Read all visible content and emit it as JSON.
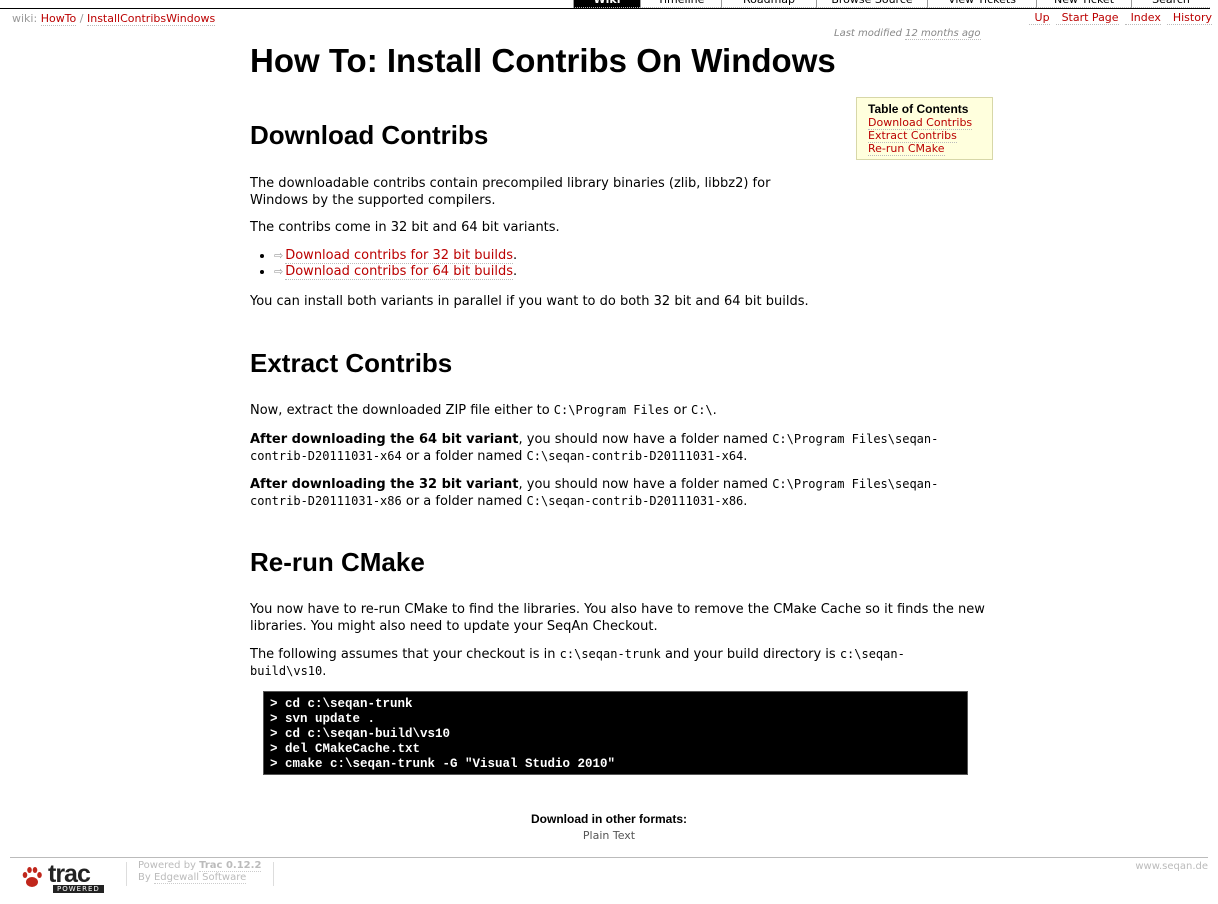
{
  "mainnav": {
    "items": [
      {
        "label": "Wiki",
        "active": true
      },
      {
        "label": "Timeline"
      },
      {
        "label": "Roadmap"
      },
      {
        "label": "Browse Source"
      },
      {
        "label": "View Tickets"
      },
      {
        "label": "New Ticket"
      },
      {
        "label": "Search"
      }
    ]
  },
  "pagepath": {
    "prefix": "wiki:",
    "parent": "HowTo",
    "separator": "/",
    "current": "InstallContribsWindows"
  },
  "ctxnav": {
    "up": "Up",
    "start_page": "Start Page",
    "index": "Index",
    "history": "History"
  },
  "lastmod": {
    "prefix": "Last modified",
    "ago": "12 months ago"
  },
  "page": {
    "title": "How To: Install Contribs On Windows"
  },
  "toc": {
    "title": "Table of Contents",
    "items": [
      "Download Contribs",
      "Extract Contribs",
      "Re-run CMake"
    ]
  },
  "download": {
    "heading": "Download Contribs",
    "p1": "The downloadable contribs contain precompiled library binaries (zlib, libbz2) for Windows by the supported compilers.",
    "p2": "The contribs come in 32 bit and 64 bit variants.",
    "link32": "Download contribs for 32 bit builds",
    "link64": "Download contribs for 64 bit builds",
    "ext_icon": "⇨",
    "p3": "You can install both variants in parallel if you want to do both 32 bit and 64 bit builds."
  },
  "extract": {
    "heading": "Extract Contribs",
    "p1_text": "Now, extract the downloaded ZIP file either to",
    "p1_code1": "C:\\Program Files",
    "p1_or": "or",
    "p1_code2": "C:\\",
    "p2_bold": "After downloading the 64 bit variant",
    "p2_text": ", you should now have a folder named",
    "p2_code1": "C:\\Program Files\\seqan-contrib-D20111031-x64",
    "p2_or": "or a folder named",
    "p2_code2": "C:\\seqan-contrib-D20111031-x64",
    "p3_bold": "After downloading the 32 bit variant",
    "p3_text": ", you should now have a folder named",
    "p3_code1": "C:\\Program Files\\seqan-contrib-D20111031-x86",
    "p3_or": "or a folder named",
    "p3_code2": "C:\\seqan-contrib-D20111031-x86"
  },
  "rerun": {
    "heading": "Re-run CMake",
    "p1": "You now have to re-run CMake to find the libraries. You also have to remove the CMake Cache so it finds the new libraries. You might also need to update your SeqAn Checkout.",
    "p2_text1": "The following assumes that your checkout is in",
    "p2_code1": "c:\\seqan-trunk",
    "p2_text2": "and your build directory is",
    "p2_code2": "c:\\seqan-build\\vs10",
    "code_lines": [
      "> cd c:\\seqan-trunk",
      "> svn update .",
      "> cd c:\\seqan-build\\vs10",
      "> del CMakeCache.txt",
      "> cmake c:\\seqan-trunk -G \"Visual Studio 2010\""
    ]
  },
  "altlinks": {
    "heading": "Download in other formats:",
    "plain_text": "Plain Text"
  },
  "footer": {
    "logo_text": "trac",
    "logo_sub": "POWERED",
    "powered_by": "Powered by",
    "trac_version": "Trac 0.12.2",
    "by": "By",
    "edgewall": "Edgewall Software",
    "site": "www.seqan.de"
  },
  "colors": {
    "link": "#bb0000",
    "toc_bg": "#ffffdd",
    "code_bg": "#000000"
  }
}
